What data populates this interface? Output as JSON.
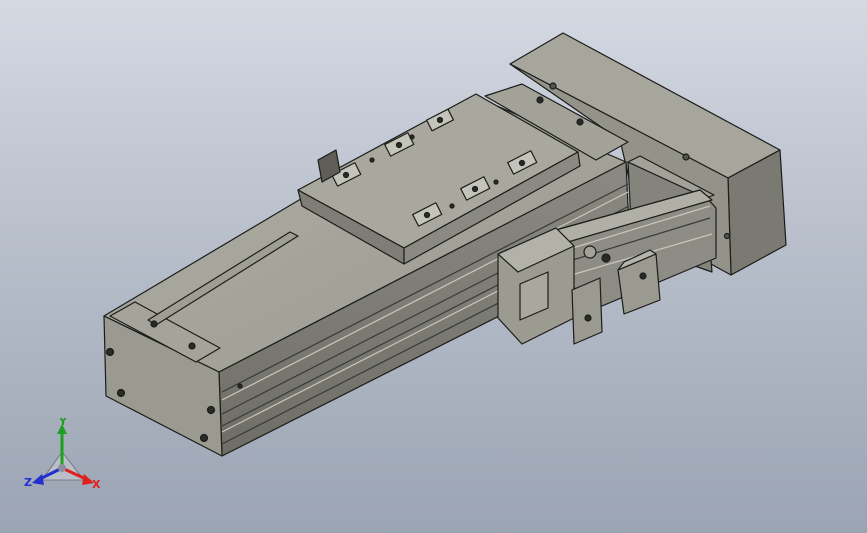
{
  "viewport": {
    "background_top": "#d4d9e2",
    "background_bottom": "#9ba4b3"
  },
  "model": {
    "body_color": "#8e8e86",
    "body_dark": "#5e5e57",
    "body_light": "#b4b4aa",
    "edge_color": "#1c1c1a"
  },
  "triad": {
    "x_label": "X",
    "y_label": "Y",
    "z_label": "Z",
    "x_color": "#e0201a",
    "y_color": "#1ea01e",
    "z_color": "#2030d0"
  }
}
